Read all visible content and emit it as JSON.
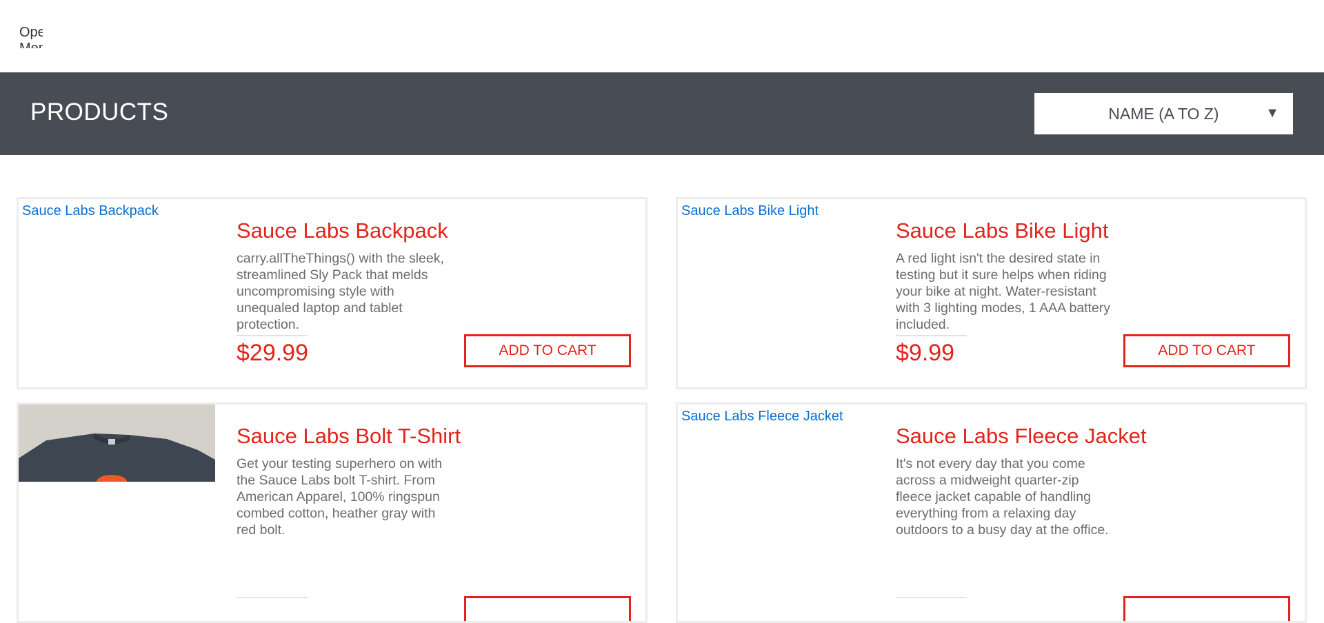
{
  "topbar": {
    "menu_label": "Open Menu"
  },
  "header": {
    "title": "PRODUCTS",
    "sort": {
      "selected": "NAME (A TO Z)",
      "arrow": "▼"
    }
  },
  "products": [
    {
      "image_alt": "Sauce Labs Backpack",
      "name": "Sauce Labs Backpack",
      "description": "carry.allTheThings() with the sleek, streamlined Sly Pack that melds uncompromising style with unequaled laptop and tablet protection.",
      "price": "$29.99",
      "button": "ADD TO CART"
    },
    {
      "image_alt": "Sauce Labs Bike Light",
      "name": "Sauce Labs Bike Light",
      "description": "A red light isn't the desired state in testing but it sure helps when riding your bike at night. Water-resistant with 3 lighting modes, 1 AAA battery included.",
      "price": "$9.99",
      "button": "ADD TO CART"
    },
    {
      "image_alt": "",
      "name": "Sauce Labs Bolt T-Shirt",
      "description": "Get your testing superhero on with the Sauce Labs bolt T-shirt. From American Apparel, 100% ringspun combed cotton, heather gray with red bolt.",
      "price": "",
      "button": ""
    },
    {
      "image_alt": "Sauce Labs Fleece Jacket",
      "name": "Sauce Labs Fleece Jacket",
      "description": "It's not every day that you come across a midweight quarter-zip fleece jacket capable of handling everything from a relaxing day outdoors to a busy day at the office.",
      "price": "",
      "button": ""
    }
  ],
  "colors": {
    "header_bg": "#474c55",
    "accent_red": "#e2231a",
    "link_blue": "#0a6ed1",
    "card_border": "#ededed"
  }
}
